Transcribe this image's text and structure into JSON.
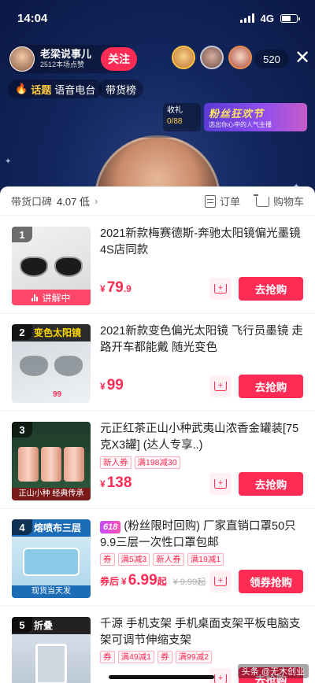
{
  "status_bar": {
    "time": "14:04",
    "network": "4G"
  },
  "host": {
    "name": "老梁说事儿",
    "likes": "2512本场点赞",
    "follow_label": "关注"
  },
  "viewers": {
    "count": "520",
    "badges": [
      "",
      "2",
      "3"
    ]
  },
  "tags": {
    "hot": "话题",
    "hot_text": "语音电台",
    "rank": "带货榜"
  },
  "gift": {
    "label": "收礼",
    "count": "0/88"
  },
  "fans_banner": {
    "title": "粉丝狂欢节",
    "subtitle": "选出你心中的人气主播"
  },
  "panel": {
    "reputation_label": "带货口碑",
    "reputation_score": "4.07 低",
    "orders_label": "订单",
    "cart_label": "购物车"
  },
  "products": [
    {
      "index": "1",
      "title": "2021新款梅赛德斯-奔驰太阳镜偏光墨镜 4S店同款",
      "price_symbol": "¥",
      "price_int": "79",
      "price_dec": ".9",
      "live_label": "讲解中",
      "buy_label": "去抢购"
    },
    {
      "index": "2",
      "thumb_label": "变色太阳镜",
      "thumb_price": "99",
      "title": " 2021新款变色偏光太阳镜  飞行员墨镜  走路开车都能戴  随光变色",
      "price_symbol": "¥",
      "price_int": "99",
      "buy_label": "去抢购"
    },
    {
      "index": "3",
      "thumb_foot": "正山小种 经典传承",
      "title": "元正红茶正山小种武夷山浓香金罐装[75克X3罐] (达人专享..)",
      "coupons": [
        "新人券",
        "满198减30"
      ],
      "price_symbol": "¥",
      "price_int": "138",
      "buy_label": "去抢购"
    },
    {
      "index": "4",
      "thumb_label": "熔喷布三层",
      "thumb_foot": "现货当天发",
      "badge": "618",
      "title": "(粉丝限时回购) 厂家直销口罩50只9.9三层一次性口罩包邮",
      "coupons": [
        "券",
        "满5减3",
        "新人券",
        "满19减1"
      ],
      "price_prefix": "券后",
      "price_symbol": "¥",
      "price_int": "6.99",
      "price_suffix": "起",
      "orig_price": "¥ 9.99起",
      "buy_label": "领券抢购"
    },
    {
      "index": "5",
      "thumb_label": "折叠",
      "title": "千源 手机支架 手机桌面支架平板电脑支架可调节伸缩支架",
      "coupons": [
        "券",
        "满49减1",
        "券",
        "满99减2"
      ],
      "buy_label": "去抢购"
    }
  ],
  "watermark": "头条 @无木创业"
}
